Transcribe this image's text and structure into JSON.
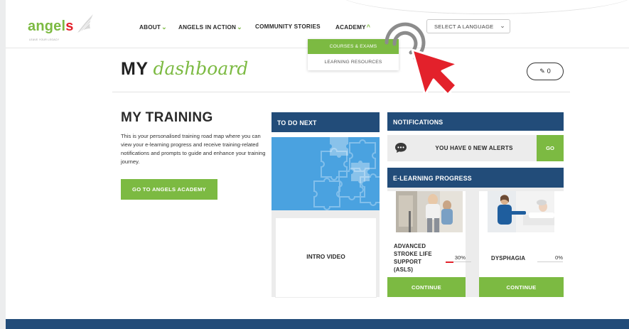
{
  "logo": {
    "text_main": "angel",
    "text_accent": "s",
    "tagline": "LEAVE YOUR LEGACY"
  },
  "nav": {
    "items": [
      {
        "label": "ABOUT",
        "chevron": "⌄"
      },
      {
        "label": "ANGELS IN ACTION",
        "chevron": "⌄"
      },
      {
        "label": "COMMUNITY STORIES",
        "chevron": ""
      },
      {
        "label": "ACADEMY",
        "chevron": "^"
      }
    ],
    "language": "SELECT A LANGUAGE"
  },
  "dropdown": {
    "items": [
      "COURSES & EXAMS",
      "LEARNING RESOURCES"
    ]
  },
  "title": {
    "my": "MY",
    "dashboard": "dashboard"
  },
  "badge": {
    "value": "0",
    "icon": "feather-icon"
  },
  "training": {
    "heading": "MY TRAINING",
    "description": "This is your personalised training road map where you can view your e-learning progress and receive training-related notifications and prompts to guide and enhance your training journey.",
    "button": "GO TO ANGELS ACADEMY"
  },
  "todo": {
    "heading": "TO DO NEXT",
    "video_label": "INTRO VIDEO"
  },
  "notifications": {
    "heading": "NOTIFICATIONS",
    "message": "YOU HAVE 0 NEW ALERTS",
    "go_label": "GO",
    "icon": "chat-bubble-icon"
  },
  "elearning": {
    "heading": "E-LEARNING PROGRESS",
    "courses": [
      {
        "name_lines": [
          "ADVANCED",
          "STROKE LIFE",
          "SUPPORT",
          "(ASLS)"
        ],
        "percent_label": "30%",
        "progress": 0.3,
        "button": "CONTINUE"
      },
      {
        "name_lines": [
          "DYSPHAGIA"
        ],
        "percent_label": "0%",
        "progress": 0,
        "button": "CONTINUE"
      }
    ]
  },
  "colors": {
    "green": "#7cba42",
    "navy": "#224c79",
    "red": "#e3212b",
    "sky": "#4aa2e0"
  }
}
